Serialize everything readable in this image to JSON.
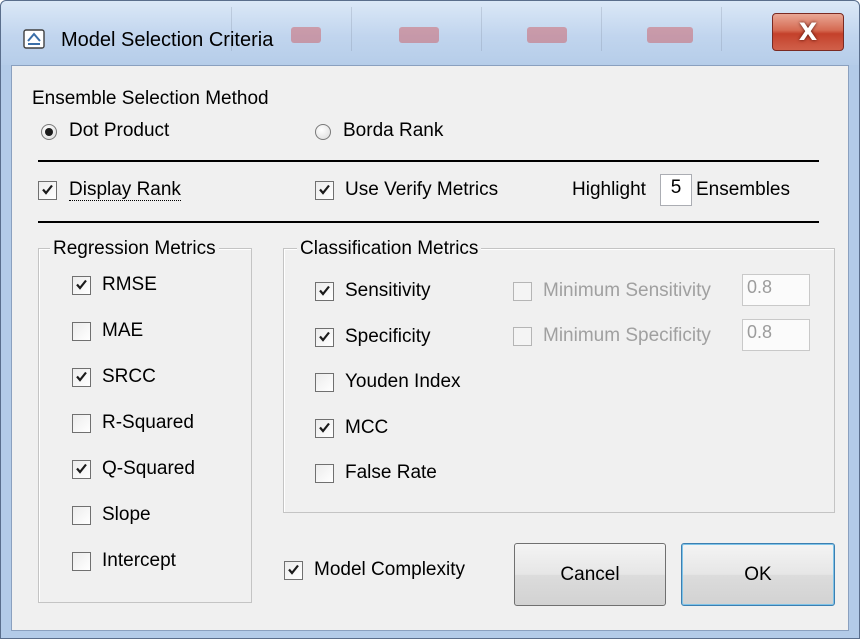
{
  "window": {
    "title": "Model Selection Criteria",
    "close_glyph": "X",
    "close_color": "#c4412b"
  },
  "ensemble": {
    "legend": "Ensemble Selection Method",
    "dot_product": {
      "label": "Dot Product",
      "selected": true
    },
    "borda_rank": {
      "label": "Borda Rank",
      "selected": false
    }
  },
  "options": {
    "display_rank": {
      "label": "Display Rank",
      "checked": true
    },
    "use_verify": {
      "label": "Use Verify Metrics",
      "checked": true
    },
    "highlight_label": "Highlight",
    "highlight_value": "5",
    "ensembles_label": "Ensembles"
  },
  "regression": {
    "legend": "Regression Metrics",
    "items": [
      {
        "label": "RMSE",
        "checked": true
      },
      {
        "label": "MAE",
        "checked": false
      },
      {
        "label": "SRCC",
        "checked": true
      },
      {
        "label": "R-Squared",
        "checked": false
      },
      {
        "label": "Q-Squared",
        "checked": true
      },
      {
        "label": "Slope",
        "checked": false
      },
      {
        "label": "Intercept",
        "checked": false
      }
    ]
  },
  "classification": {
    "legend": "Classification Metrics",
    "items": [
      {
        "label": "Sensitivity",
        "checked": true
      },
      {
        "label": "Specificity",
        "checked": true
      },
      {
        "label": "Youden Index",
        "checked": false
      },
      {
        "label": "MCC",
        "checked": true
      },
      {
        "label": "False Rate",
        "checked": false
      }
    ],
    "min_sensitivity": {
      "label": "Minimum Sensitivity",
      "checked": false,
      "value": "0.8"
    },
    "min_specificity": {
      "label": "Minimum Specificity",
      "checked": false,
      "value": "0.8"
    }
  },
  "model_complexity": {
    "label": "Model Complexity",
    "checked": true
  },
  "buttons": {
    "cancel": "Cancel",
    "ok": "OK"
  }
}
